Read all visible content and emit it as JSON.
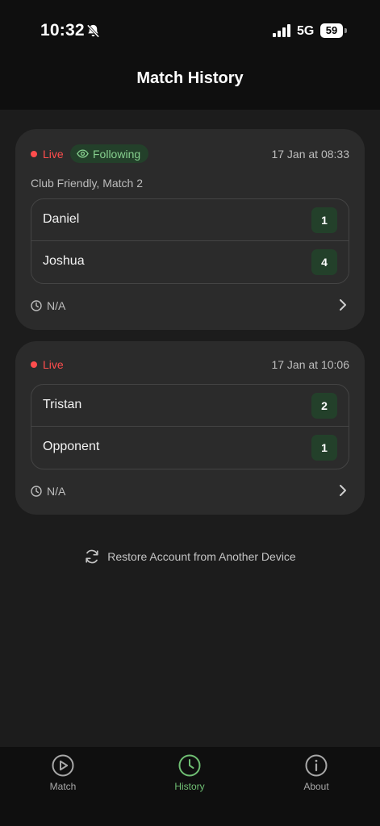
{
  "status_bar": {
    "time": "10:32",
    "network": "5G",
    "battery": "59"
  },
  "header": {
    "title": "Match History"
  },
  "matches": [
    {
      "live_label": "Live",
      "following_label": "Following",
      "date": "17 Jan at 08:33",
      "subtitle": "Club Friendly, Match 2",
      "players": [
        {
          "name": "Daniel",
          "score": "1"
        },
        {
          "name": "Joshua",
          "score": "4"
        }
      ],
      "duration": "N/A"
    },
    {
      "live_label": "Live",
      "date": "17 Jan at 10:06",
      "players": [
        {
          "name": "Tristan",
          "score": "2"
        },
        {
          "name": "Opponent",
          "score": "1"
        }
      ],
      "duration": "N/A"
    }
  ],
  "restore_label": "Restore Account from Another Device",
  "tabs": [
    {
      "label": "Match",
      "icon": "play-circle-icon"
    },
    {
      "label": "History",
      "icon": "clock-icon",
      "active": true
    },
    {
      "label": "About",
      "icon": "info-icon"
    }
  ],
  "colors": {
    "accent": "#6fbf73",
    "live": "#ff4d4d",
    "card": "#2b2b2b",
    "score_bg": "#23402a"
  }
}
